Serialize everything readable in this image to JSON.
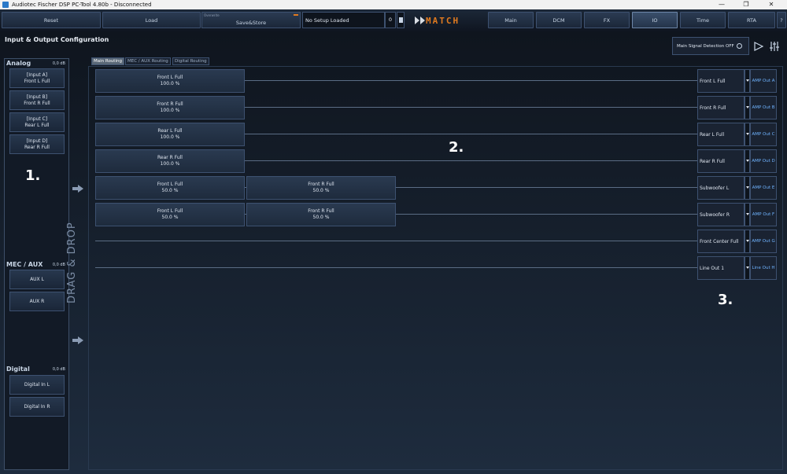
{
  "window": {
    "title": "Audiotec Fischer DSP PC-Tool 4.80b - Disconnected",
    "minimize": "—",
    "maximize": "❐",
    "close": "✕"
  },
  "toolbar": {
    "reset": "Reset",
    "load": "Load",
    "save_overwrite": "Overwrite",
    "save_store": "Save&Store",
    "setup_name": "No Setup Loaded",
    "setup_number": "0",
    "logo": "MATCH",
    "tabs": [
      "Main",
      "DCM",
      "FX",
      "IO",
      "Time",
      "RTA"
    ],
    "help": "?"
  },
  "page": {
    "title": "Input & Output Configuration",
    "signal_detection": "Main Signal Detection OFF"
  },
  "left": {
    "analog_title": "Analog",
    "analog_db": "0,0 dB",
    "analog_inputs": [
      {
        "line1": "[Input A]",
        "line2": "Front L Full"
      },
      {
        "line1": "[Input B]",
        "line2": "Front R Full"
      },
      {
        "line1": "[Input C]",
        "line2": "Rear L Full"
      },
      {
        "line1": "[Input D]",
        "line2": "Rear R Full"
      }
    ],
    "mec_title": "MEC / AUX",
    "mec_db": "0,0 dB",
    "mec_inputs": [
      "AUX L",
      "AUX R"
    ],
    "digital_title": "Digital",
    "digital_db": "0,0 dB",
    "digital_inputs": [
      "Digital In L",
      "Digital In R"
    ]
  },
  "drag_drop": "DRAG & DROP",
  "tabs": [
    "Main Routing",
    "MEC / AUX Routing",
    "Digital Routing"
  ],
  "routing": [
    {
      "col1": {
        "name": "Front L Full",
        "pct": "100.0 %"
      },
      "output": "Front L Full",
      "amp": "AMP Out A"
    },
    {
      "col1": {
        "name": "Front R Full",
        "pct": "100.0 %"
      },
      "output": "Front R Full",
      "amp": "AMP Out B"
    },
    {
      "col1": {
        "name": "Rear L Full",
        "pct": "100.0 %"
      },
      "output": "Rear L Full",
      "amp": "AMP Out C"
    },
    {
      "col1": {
        "name": "Rear R Full",
        "pct": "100.0 %"
      },
      "output": "Rear R Full",
      "amp": "AMP Out D"
    },
    {
      "col1": {
        "name": "Front L Full",
        "pct": "50.0 %"
      },
      "col2": {
        "name": "Front R Full",
        "pct": "50.0 %"
      },
      "output": "Subwoofer L",
      "amp": "AMP Out E"
    },
    {
      "col1": {
        "name": "Front L Full",
        "pct": "50.0 %"
      },
      "col2": {
        "name": "Front R Full",
        "pct": "50.0 %"
      },
      "output": "Subwoofer R",
      "amp": "AMP Out F"
    },
    {
      "output": "Front Center Full",
      "amp": "AMP Out G"
    },
    {
      "output": "Line Out 1",
      "amp": "Line Out H"
    }
  ],
  "annotations": [
    "1.",
    "2.",
    "3."
  ]
}
